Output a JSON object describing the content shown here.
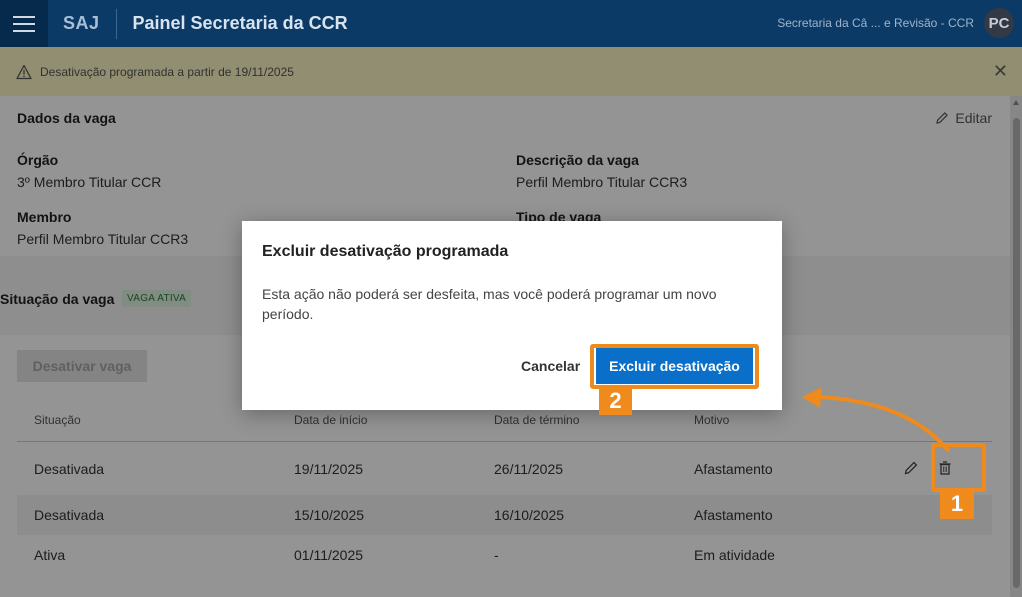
{
  "header": {
    "brand": "SAJ",
    "title": "Painel Secretaria da CCR",
    "user_name": "Secretaria da Câ ... e Revisão - CCR",
    "avatar_initials": "PC"
  },
  "banner": {
    "text": "Desativação programada a partir de 19/11/2025"
  },
  "card": {
    "title": "Dados da vaga",
    "edit_label": "Editar",
    "fields": [
      {
        "label": "Órgão",
        "value": "3º Membro Titular CCR"
      },
      {
        "label": "Descrição da vaga",
        "value": "Perfil Membro Titular CCR3"
      },
      {
        "label": "Membro",
        "value": "Perfil Membro Titular CCR3"
      },
      {
        "label": "Tipo de vaga",
        "value": ""
      }
    ]
  },
  "situacao": {
    "title": "Situação da vaga",
    "badge": "VAGA ATIVA",
    "deactivate_label": "Desativar vaga",
    "columns": [
      "Situação",
      "Data de início",
      "Data de término",
      "Motivo"
    ],
    "rows": [
      {
        "situacao": "Desativada",
        "inicio": "19/11/2025",
        "termino": "26/11/2025",
        "motivo": "Afastamento"
      },
      {
        "situacao": "Desativada",
        "inicio": "15/10/2025",
        "termino": "16/10/2025",
        "motivo": "Afastamento"
      },
      {
        "situacao": "Ativa",
        "inicio": "01/11/2025",
        "termino": "-",
        "motivo": "Em atividade"
      }
    ]
  },
  "dialog": {
    "title": "Excluir desativação programada",
    "body": "Esta ação não poderá ser desfeita, mas você poderá programar um novo período.",
    "cancel_label": "Cancelar",
    "confirm_label": "Excluir desativação"
  },
  "annotations": {
    "step1": "1",
    "step2": "2",
    "color": "#ef8a1c"
  }
}
